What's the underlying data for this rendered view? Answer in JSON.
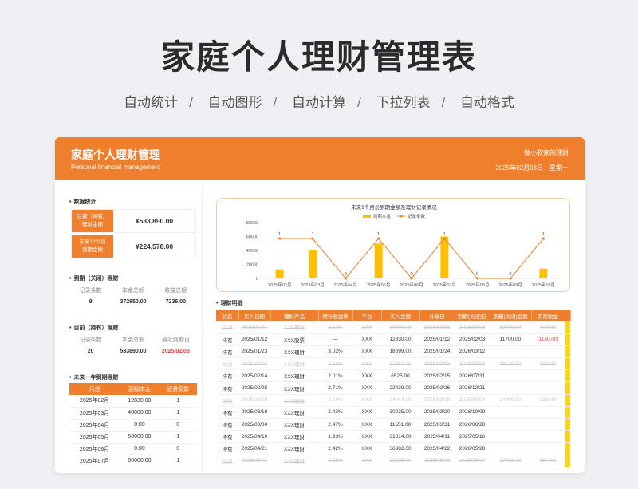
{
  "page": {
    "title": "家庭个人理财管理表",
    "features": [
      "自动统计",
      "自动图形",
      "自动计算",
      "下拉列表",
      "自动格式"
    ]
  },
  "header": {
    "title": "家庭个人理财管理",
    "subtitle": "Personal financial management",
    "brand": "做小软家的理财",
    "date": "2025年02月03日",
    "weekday": "星期一"
  },
  "stats": {
    "section": "数据统计",
    "holding_label_1": "目前（持有）",
    "holding_label_2": "理财金额",
    "holding_value": "¥533,890.00",
    "due_label_1": "未来12个月",
    "due_label_2": "到期金额",
    "due_value": "¥224,578.00"
  },
  "closed": {
    "section": "到期（关闭）理财",
    "headers": [
      "记录条数",
      "本金总额",
      "收益总额"
    ],
    "values": [
      "9",
      "372850.00",
      "7236.00"
    ]
  },
  "holding": {
    "section": "目前（持有）理财",
    "headers": [
      "记录条数",
      "本金总额",
      "最近到期日"
    ],
    "values": [
      "20",
      "533890.00",
      "2025/02/03"
    ]
  },
  "year": {
    "section": "未来一年到期理财",
    "headers": [
      "月份",
      "到期本金",
      "记录条数"
    ],
    "rows": [
      [
        "2025年02月",
        "12830.00",
        "1"
      ],
      [
        "2025年03月",
        "40000.00",
        "1"
      ],
      [
        "2025年04月",
        "0.00",
        "0"
      ],
      [
        "2025年05月",
        "50000.00",
        "1"
      ],
      [
        "2025年06月",
        "0.00",
        "0"
      ],
      [
        "2025年07月",
        "60000.00",
        "1"
      ]
    ]
  },
  "chart_data": {
    "type": "bar",
    "title": "未来9个月份到期金额及理财记录情况",
    "categories": [
      "2025年02月",
      "2025年03月",
      "2025年04月",
      "2025年05月",
      "2025年06月",
      "2025年07月",
      "2025年08月",
      "2025年09月",
      "2025年10月"
    ],
    "series": [
      {
        "name": "到期本金",
        "type": "bar",
        "color": "#ffc000",
        "values": [
          12830,
          40000,
          0,
          50000,
          0,
          60000,
          0,
          0,
          14000
        ]
      },
      {
        "name": "记录条数",
        "type": "line",
        "color": "#ef7f2c",
        "values": [
          1,
          1,
          0,
          1,
          0,
          1,
          0,
          0,
          1
        ]
      }
    ],
    "yticks": [
      "80000",
      "60000",
      "40000",
      "20000",
      "0"
    ],
    "ylim": [
      0,
      80000
    ],
    "legend": "top"
  },
  "detail": {
    "section": "理财明细",
    "headers": [
      "状态",
      "买入日期",
      "理财产品",
      "预计收益率",
      "平台",
      "买入金额",
      "计息日",
      "到期(关闭)日",
      "到期(关闭)金额",
      "实际收益"
    ],
    "rows": [
      {
        "closed": true,
        "cells": [
          "关闭",
          "2025/01/01",
          "XXX理财",
          "3.11%",
          "XXX",
          "30000.00",
          "2025/01/01",
          "2025/01/03",
          "30400.00",
          "400.00"
        ]
      },
      {
        "closed": false,
        "cells": [
          "持有",
          "2025/01/12",
          "XXX股票",
          "—",
          "XXX",
          "12830.00",
          "2025/01/12",
          "2025/02/03",
          "11700.00",
          "(1130.00)"
        ]
      },
      {
        "closed": false,
        "cells": [
          "持有",
          "2025/01/23",
          "XXX理财",
          "3.02%",
          "XXX",
          "18099.00",
          "2025/01/24",
          "2026/03/12",
          "",
          ""
        ]
      },
      {
        "closed": true,
        "cells": [
          "关闭",
          "2025/02/03",
          "XXX理财",
          "2.56%",
          "XXX",
          "37561.00",
          "2025/02/04",
          "2025/05/03",
          "38120.00",
          "559.00"
        ]
      },
      {
        "closed": false,
        "cells": [
          "持有",
          "2025/02/14",
          "XXX理财",
          "2.01%",
          "XXX",
          "6525.00",
          "2025/02/15",
          "2026/07/31",
          "",
          ""
        ]
      },
      {
        "closed": false,
        "cells": [
          "持有",
          "2025/02/25",
          "XXX理财",
          "2.71%",
          "XXX",
          "22439.00",
          "2025/02/26",
          "2026/12/21",
          "",
          ""
        ]
      },
      {
        "closed": true,
        "cells": [
          "关闭",
          "2025/03/08",
          "XXX理财",
          "2.02%",
          "XXX",
          "24464.00",
          "2025/03/09",
          "2025/05/03",
          "24800.00",
          "336.00"
        ]
      },
      {
        "closed": false,
        "cells": [
          "持有",
          "2025/03/19",
          "XXX理财",
          "2.43%",
          "XXX",
          "30025.00",
          "2025/03/20",
          "2026/10/09",
          "",
          ""
        ]
      },
      {
        "closed": false,
        "cells": [
          "持有",
          "2025/03/30",
          "XXX理财",
          "2.47%",
          "XXX",
          "11551.00",
          "2025/03/31",
          "2026/06/28",
          "",
          ""
        ]
      },
      {
        "closed": false,
        "cells": [
          "持有",
          "2025/04/10",
          "XXX理财",
          "1.93%",
          "XXX",
          "31314.00",
          "2025/04/11",
          "2025/05/16",
          "",
          ""
        ]
      },
      {
        "closed": false,
        "cells": [
          "持有",
          "2025/04/21",
          "XXX理财",
          "2.42%",
          "XXX",
          "36382.00",
          "2025/04/22",
          "2026/05/28",
          "",
          ""
        ]
      },
      {
        "closed": true,
        "cells": [
          "关闭",
          "2025/05/02",
          "XXX理财",
          "2.26%",
          "XXX",
          "20825.00",
          "2025/05/03",
          "2025/05/07",
          "20768.00",
          "(57.00)"
        ]
      }
    ]
  }
}
